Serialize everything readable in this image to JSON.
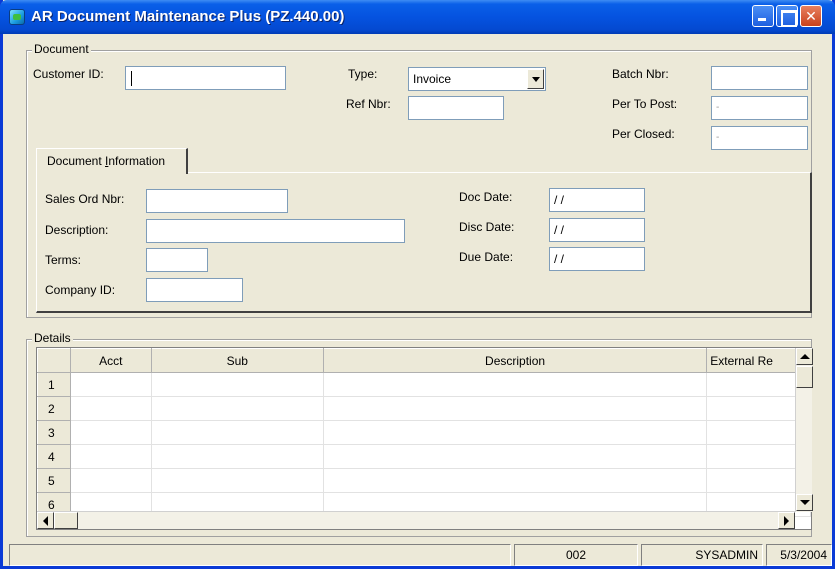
{
  "window": {
    "title": "AR Document Maintenance Plus (PZ.440.00)"
  },
  "document_group": {
    "legend": "Document",
    "customer_id_label": "Customer ID:",
    "customer_id_value": "",
    "type_label": "Type:",
    "type_value": "Invoice",
    "ref_nbr_label": "Ref Nbr:",
    "ref_nbr_value": "",
    "batch_nbr_label": "Batch Nbr:",
    "batch_nbr_value": "",
    "per_to_post_label": "Per To Post:",
    "per_to_post_value": "-",
    "per_closed_label": "Per Closed:",
    "per_closed_value": "-"
  },
  "doc_info_tab": {
    "tab_prefix": "Document ",
    "tab_underlined": "I",
    "tab_suffix": "nformation",
    "sales_ord_nbr_label": "Sales Ord Nbr:",
    "description_label": "Description:",
    "terms_label": "Terms:",
    "company_id_label": "Company ID:",
    "doc_date_label": "Doc Date:",
    "doc_date_value": "/ /",
    "disc_date_label": "Disc Date:",
    "disc_date_value": "/ /",
    "due_date_label": "Due Date:",
    "due_date_value": "/ /"
  },
  "details": {
    "legend": "Details",
    "columns": [
      "Acct",
      "Sub",
      "Description",
      "External Re"
    ],
    "row_numbers": [
      "1",
      "2",
      "3",
      "4",
      "5",
      "6"
    ]
  },
  "statusbar": {
    "message": "",
    "company": "002",
    "user": "SYSADMIN",
    "date": "5/3/2004"
  },
  "colors": {
    "titlebar": "#0553e0",
    "window_bg": "#ece9d8",
    "close_button": "#c9421d"
  }
}
